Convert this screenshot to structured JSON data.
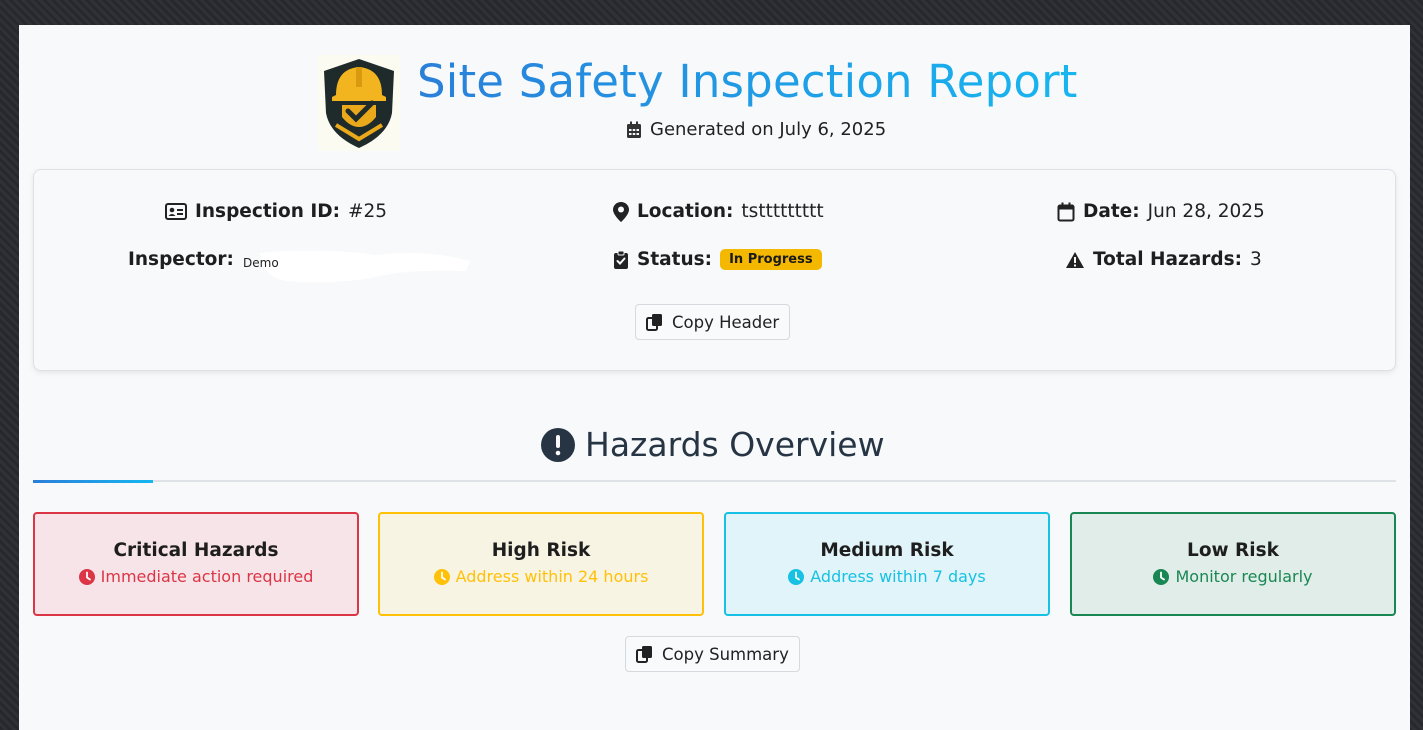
{
  "header": {
    "title": "Site Safety Inspection Report",
    "generated": "Generated on July 6, 2025"
  },
  "info": {
    "inspection_id_label": "Inspection ID:",
    "inspection_id": "#25",
    "location_label": "Location:",
    "location": "tsttttttttt",
    "date_label": "Date:",
    "date": "Jun 28, 2025",
    "inspector_label": "Inspector:",
    "inspector": "Demo",
    "status_label": "Status:",
    "status": "In Progress",
    "total_label": "Total Hazards:",
    "total": "3",
    "copy_header": "Copy Header"
  },
  "hazards": {
    "title": "Hazards Overview",
    "cards": [
      {
        "title": "Critical Hazards",
        "subtitle": "Immediate action required",
        "color": "#dc3545",
        "bg": "#f6e4e8"
      },
      {
        "title": "High Risk",
        "subtitle": "Address within 24 hours",
        "color": "#ffc107",
        "bg": "#f8f4e3"
      },
      {
        "title": "Medium Risk",
        "subtitle": "Address within 7 days",
        "color": "#17c1e3",
        "bg": "#e1f4f9"
      },
      {
        "title": "Low Risk",
        "subtitle": "Monitor regularly",
        "color": "#198754",
        "bg": "#e1ede8"
      }
    ],
    "copy_summary": "Copy Summary"
  },
  "icons": {
    "logo": "safety-helmet-shield-logo",
    "calendar": "calendar-icon",
    "id": "id-card-icon",
    "location": "map-pin-icon",
    "date": "calendar-icon",
    "status": "clipboard-check-icon",
    "total": "warning-triangle-icon",
    "copy": "copy-icon",
    "exclamation": "exclamation-circle-icon",
    "clock": "clock-icon"
  }
}
